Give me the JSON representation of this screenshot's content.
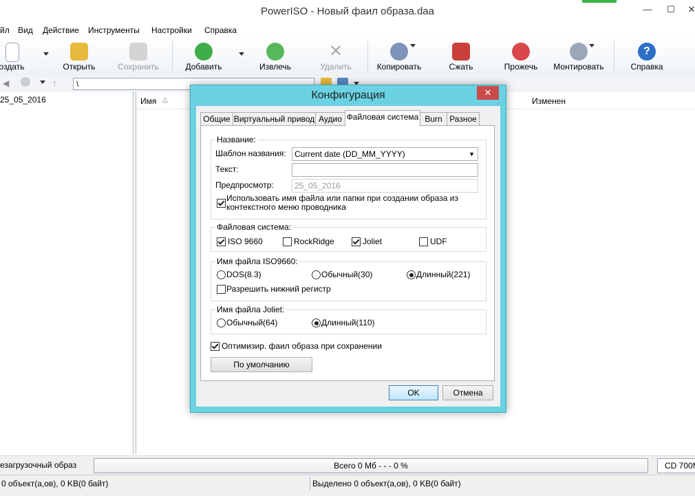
{
  "window": {
    "title": "PowerISO - Новый фаил образа.daa"
  },
  "menu": [
    "йл",
    "Вид",
    "Действие",
    "Инструменты",
    "Настройки",
    "Справка"
  ],
  "toolbar": {
    "create": "оздать",
    "open": "Открыть",
    "save": "Сохранить",
    "add": "Добавить",
    "extract": "Извлечь",
    "delete": "Удалить",
    "copy": "Копировать",
    "compress": "Сжать",
    "burn": "Прожечь",
    "mount": "Монтировать",
    "help": "Справка"
  },
  "address": {
    "path": "\\"
  },
  "tree": {
    "root": "25_05_2016"
  },
  "columns": {
    "name": "Имя",
    "modified": "Изменен"
  },
  "status": {
    "boot": "езагрузочный образ",
    "total": "Всего  0 Мб   - - -  0 %",
    "media": "CD 700M",
    "left_info": "0 объект(а,ов), 0 KB(0 байт)",
    "selected": "Выделено 0 объект(а,ов), 0 KB(0 байт)"
  },
  "dialog": {
    "title": "Конфигурация",
    "close_glyph": "✕",
    "tabs": [
      "Общие",
      "Виртуальный привод",
      "Аудио",
      "Файловая система",
      "Burn",
      "Разное"
    ],
    "active_tab": 3,
    "name_group": {
      "title": "Название:",
      "template_label": "Шаблон названия:",
      "template_value": "Current date (DD_MM_YYYY)",
      "text_label": "Текст:",
      "text_value": "",
      "preview_label": "Предпросмотр:",
      "preview_value": "25_05_2016",
      "use_name_label_1": "Использовать имя файла или папки при создании образа из",
      "use_name_label_2": "контекстного меню проводника",
      "use_name_checked": true
    },
    "fs_group": {
      "title": "Файловая система:",
      "items": [
        {
          "label": "ISO 9660",
          "checked": true
        },
        {
          "label": "RockRidge",
          "checked": false
        },
        {
          "label": "Joliet",
          "checked": true
        },
        {
          "label": "UDF",
          "checked": false
        }
      ]
    },
    "iso_group": {
      "title": "Имя файла ISO9660:",
      "options": [
        {
          "label": "DOS(8.3)",
          "selected": false
        },
        {
          "label": "Обычный(30)",
          "selected": false
        },
        {
          "label": "Длинный(221)",
          "selected": true
        }
      ],
      "lowercase_label": "Разрешить нижний регистр",
      "lowercase_checked": false
    },
    "joliet_group": {
      "title": "Имя файла Joliet:",
      "options": [
        {
          "label": "Обычный(64)",
          "selected": false
        },
        {
          "label": "Длинный(110)",
          "selected": true
        }
      ]
    },
    "optimize_label": "Оптимизир. фаил образа при сохранении",
    "optimize_checked": true,
    "default_button": "По умолчанию",
    "ok": "OK",
    "cancel": "Отмена"
  },
  "colors": {
    "dialog_frame": "#6ad2e3",
    "close_button": "#c94b4b"
  }
}
